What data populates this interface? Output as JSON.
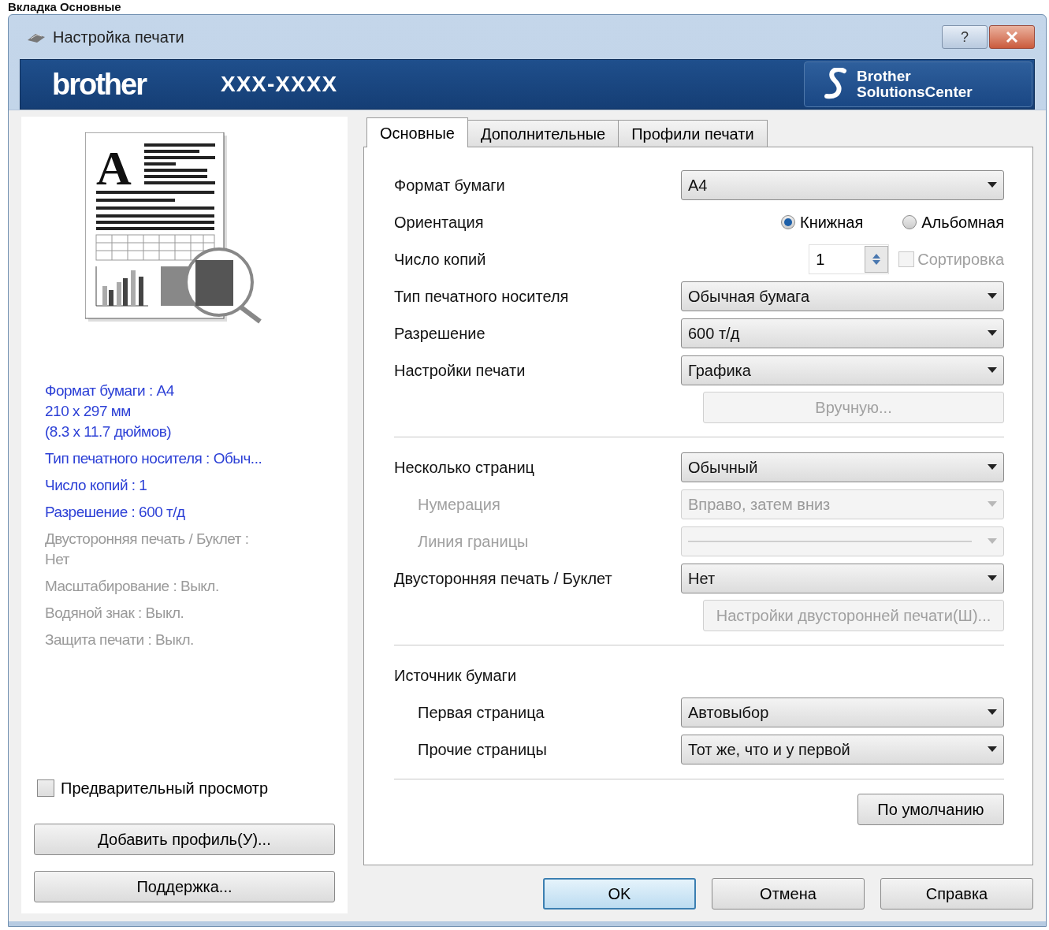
{
  "page_heading": "Вкладка Основные",
  "window": {
    "title": "Настройка печати",
    "help": "?"
  },
  "preview_letter": "A",
  "banner": {
    "logo": "brother",
    "model": "XXX-XXXX",
    "solutions": [
      "Brother",
      "SolutionsCenter"
    ]
  },
  "summary": [
    {
      "lines": [
        "Формат бумаги : A4",
        "210 x 297 мм",
        "(8.3 x 11.7 дюймов)"
      ],
      "active": true
    },
    {
      "lines": [
        "Тип печатного носителя : Обыч..."
      ],
      "active": true
    },
    {
      "lines": [
        "Число копий : 1"
      ],
      "active": true
    },
    {
      "lines": [
        "Разрешение : 600 т/д"
      ],
      "active": true
    },
    {
      "lines": [
        "Двусторонняя печать / Буклет :",
        "Нет"
      ],
      "active": false
    },
    {
      "lines": [
        "Масштабирование : Выкл."
      ],
      "active": false
    },
    {
      "lines": [
        "Водяной знак : Выкл."
      ],
      "active": false
    },
    {
      "lines": [
        "Защита печати : Выкл."
      ],
      "active": false
    }
  ],
  "preview": {
    "label": "Предварительный просмотр",
    "checked": false
  },
  "left_buttons": [
    "Добавить профиль(У)...",
    "Поддержка..."
  ],
  "tabs": [
    {
      "label": "Основные",
      "selected": true
    },
    {
      "label": "Дополнительные",
      "selected": false
    },
    {
      "label": "Профили печати",
      "selected": false
    }
  ],
  "settings": [
    {
      "kind": "select",
      "label": "Формат бумаги",
      "value": "A4",
      "disabled": false
    },
    {
      "kind": "radio",
      "label": "Ориентация",
      "options": [
        {
          "label": "Книжная",
          "selected": true
        },
        {
          "label": "Альбомная",
          "selected": false
        }
      ]
    },
    {
      "kind": "spinner",
      "label": "Число копий",
      "value": "1",
      "checkbox": {
        "label": "Сортировка",
        "checked": false,
        "disabled": true
      }
    },
    {
      "kind": "select",
      "label": "Тип печатного носителя",
      "value": "Обычная бумага",
      "disabled": false
    },
    {
      "kind": "select",
      "label": "Разрешение",
      "value": "600 т/д",
      "disabled": false
    },
    {
      "kind": "select",
      "label": "Настройки печати",
      "value": "Графика",
      "disabled": false
    },
    {
      "kind": "button",
      "label": "Вручную...",
      "disabled": true
    },
    {
      "kind": "separator"
    },
    {
      "kind": "select",
      "label": "Несколько страниц",
      "value": "Обычный",
      "disabled": false,
      "children": [
        {
          "kind": "select",
          "label": "Нумерация",
          "value": "Вправо, затем вниз",
          "disabled": true
        },
        {
          "kind": "line-select",
          "label": "Линия границы",
          "disabled": true
        }
      ]
    },
    {
      "kind": "select",
      "label": "Двусторонняя печать / Буклет",
      "value": "Нет",
      "disabled": false
    },
    {
      "kind": "button",
      "label": "Настройки двусторонней печати(Ш)...",
      "disabled": true
    },
    {
      "kind": "separator"
    },
    {
      "kind": "heading",
      "label": "Источник бумаги",
      "children": [
        {
          "kind": "select",
          "label": "Первая страница",
          "value": "Автовыбор",
          "disabled": false
        },
        {
          "kind": "select",
          "label": "Прочие страницы",
          "value": "Тот же, что и у первой",
          "disabled": false
        }
      ]
    },
    {
      "kind": "separator"
    }
  ],
  "defaults_button": {
    "label": "По умолчанию",
    "disabled": false
  },
  "footer_buttons": [
    {
      "label": "OK",
      "default": true
    },
    {
      "label": "Отмена",
      "default": false
    },
    {
      "label": "Справка",
      "default": false
    }
  ]
}
